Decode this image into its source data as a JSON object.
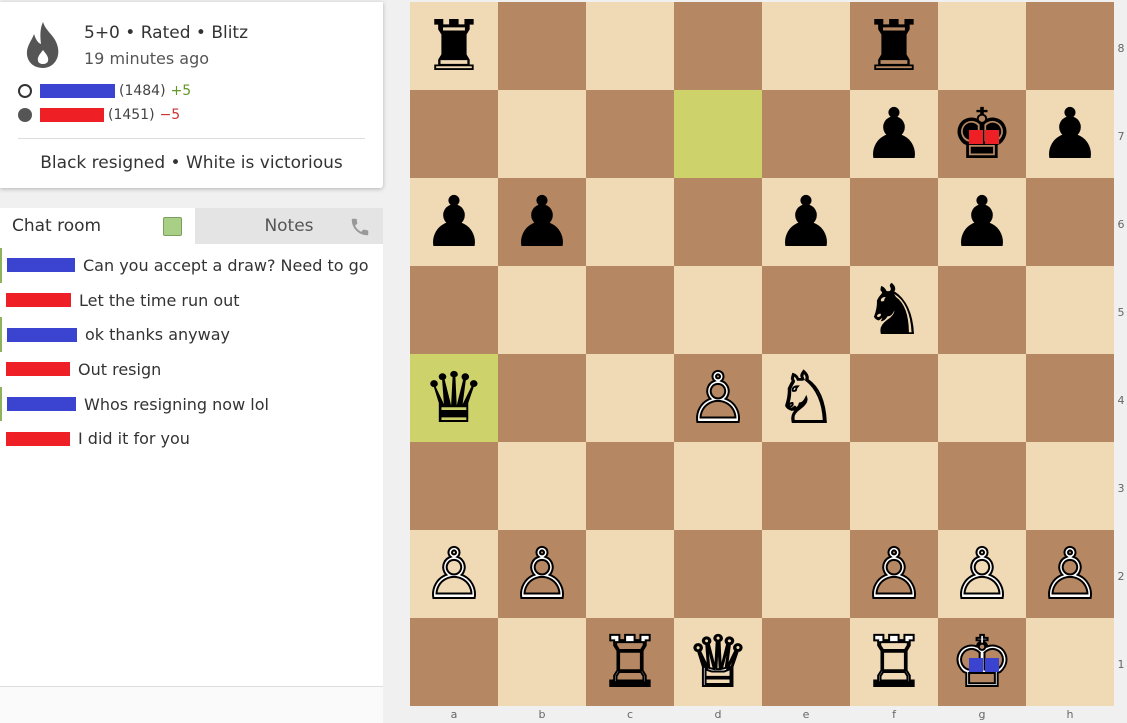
{
  "game": {
    "title": "5+0 • Rated • Blitz",
    "time_ago": "19 minutes ago",
    "white_player": {
      "rating": "(1484)",
      "diff": "+5"
    },
    "black_player": {
      "rating": "(1451)",
      "diff": "−5"
    },
    "status": "Black resigned • White is victorious"
  },
  "chat": {
    "tab_chat": "Chat room",
    "tab_notes": "Notes",
    "messages": [
      {
        "text": "Can you accept a draw? Need to go",
        "color": "#3a44d1"
      },
      {
        "text": "Let the time run out",
        "color": "#ee1f25"
      },
      {
        "text": "ok thanks anyway",
        "color": "#3a44d1"
      },
      {
        "text": "Out resign",
        "color": "#ee1f25"
      },
      {
        "text": "Whos resigning now lol",
        "color": "#3a44d1"
      },
      {
        "text": "I did it for you",
        "color": "#ee1f25"
      }
    ]
  },
  "board": {
    "files": [
      "a",
      "b",
      "c",
      "d",
      "e",
      "f",
      "g",
      "h"
    ],
    "ranks": [
      "8",
      "7",
      "6",
      "5",
      "4",
      "3",
      "2",
      "1"
    ],
    "highlighted_squares": [
      "d7",
      "a4"
    ],
    "pieces": [
      {
        "square": "a8",
        "piece": "rook",
        "color": "black"
      },
      {
        "square": "f8",
        "piece": "rook",
        "color": "black"
      },
      {
        "square": "f7",
        "piece": "pawn",
        "color": "black"
      },
      {
        "square": "g7",
        "piece": "king",
        "color": "black"
      },
      {
        "square": "h7",
        "piece": "pawn",
        "color": "black"
      },
      {
        "square": "a6",
        "piece": "pawn",
        "color": "black"
      },
      {
        "square": "b6",
        "piece": "pawn",
        "color": "black"
      },
      {
        "square": "e6",
        "piece": "pawn",
        "color": "black"
      },
      {
        "square": "g6",
        "piece": "pawn",
        "color": "black"
      },
      {
        "square": "f5",
        "piece": "knight",
        "color": "black"
      },
      {
        "square": "a4",
        "piece": "queen",
        "color": "black"
      },
      {
        "square": "d4",
        "piece": "pawn",
        "color": "white"
      },
      {
        "square": "e4",
        "piece": "knight",
        "color": "white"
      },
      {
        "square": "a2",
        "piece": "pawn",
        "color": "white"
      },
      {
        "square": "b2",
        "piece": "pawn",
        "color": "white"
      },
      {
        "square": "f2",
        "piece": "pawn",
        "color": "white"
      },
      {
        "square": "g2",
        "piece": "pawn",
        "color": "white"
      },
      {
        "square": "h2",
        "piece": "pawn",
        "color": "white"
      },
      {
        "square": "c1",
        "piece": "rook",
        "color": "white"
      },
      {
        "square": "d1",
        "piece": "queen",
        "color": "white"
      },
      {
        "square": "f1",
        "piece": "rook",
        "color": "white"
      },
      {
        "square": "g1",
        "piece": "king",
        "color": "white"
      }
    ]
  },
  "colors": {
    "light_square": "#f0d9b5",
    "dark_square": "#b58863",
    "highlight": "#cdd26a",
    "white_player": "#3a44d1",
    "black_player": "#ee1f25"
  }
}
